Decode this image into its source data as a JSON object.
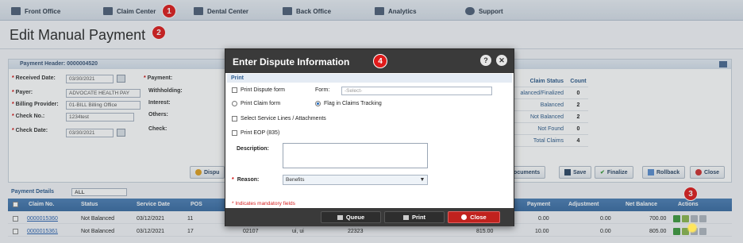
{
  "nav": {
    "items": [
      {
        "label": "Front Office",
        "icon": "front-office-icon"
      },
      {
        "label": "Claim Center",
        "icon": "claim-center-icon"
      },
      {
        "label": "Dental Center",
        "icon": "dental-center-icon"
      },
      {
        "label": "Back Office",
        "icon": "back-office-icon"
      },
      {
        "label": "Analytics",
        "icon": "analytics-icon"
      },
      {
        "label": "Support",
        "icon": "support-icon"
      }
    ]
  },
  "page": {
    "title": "Edit Manual Payment"
  },
  "badges": [
    "1",
    "2",
    "3",
    "4"
  ],
  "payment_header": {
    "title": "Payment Header: 0000004520",
    "received_date_label": "Received Date:",
    "received_date": "03/30/2021",
    "payer_label": "Payer:",
    "payer": "ADVOCATE HEALTH PAY",
    "billing_provider_label": "Billing Provider:",
    "billing_provider": "01-BILL Billing Office",
    "check_no_label": "Check No.:",
    "check_no": "1234test",
    "check_date_label": "Check Date:",
    "check_date": "03/30/2021",
    "payment_label": "Payment:",
    "withholding_label": "Withholding:",
    "interest_label": "Interest:",
    "others_label": "Others:",
    "check_label": "Check:"
  },
  "claim_status": {
    "header": "Claim Status",
    "count_header": "Count",
    "rows": [
      {
        "label": "alanced/Finalized",
        "count": "0"
      },
      {
        "label": "Balanced",
        "count": "2"
      },
      {
        "label": "Not Balanced",
        "count": "2"
      },
      {
        "label": "Not Found",
        "count": "0"
      },
      {
        "label": "Total Claims",
        "count": "4"
      }
    ]
  },
  "actions": {
    "dispute": "Dispu",
    "documents": "Documents",
    "save": "Save",
    "finalize": "Finalize",
    "rollback": "Rollback",
    "close": "Close"
  },
  "details": {
    "title": "Payment Details",
    "filter": "ALL",
    "columns": [
      "Claim No.",
      "Status",
      "Service Date",
      "POS",
      "Payment",
      "Adjustment",
      "Net Balance",
      "Actions"
    ],
    "rows": [
      {
        "claim": "0000015360",
        "status": "Not Balanced",
        "date": "03/12/2021",
        "pos": "11",
        "c5": "",
        "c6": "",
        "c7": "",
        "c8": "",
        "payment": "0.00",
        "adjustment": "0.00",
        "net": "700.00"
      },
      {
        "claim": "0000015361",
        "status": "Not Balanced",
        "date": "03/12/2021",
        "pos": "17",
        "c5": "02107",
        "c6": "ui, ui",
        "c7": "22323",
        "c8": "815.00",
        "payment": "10.00",
        "adjustment": "0.00",
        "net": "805.00"
      }
    ]
  },
  "modal": {
    "title": "Enter Dispute Information",
    "section": "Print",
    "print_dispute": "Print Dispute form",
    "form_label": "Form:",
    "form_placeholder": "-Select-",
    "print_claim": "Print Claim form",
    "flag_tracking": "Flag in Claims Tracking",
    "select_lines": "Select Service Lines / Attachments",
    "print_eop": "Print EOP (835)",
    "description_label": "Description:",
    "reason_label": "Reason:",
    "reason_value": "Benefits",
    "mandatory_note": "* Indicates mandatory fields",
    "queue": "Queue",
    "print": "Print",
    "close": "Close"
  },
  "colors": {
    "accent": "#3a6ca2",
    "badge": "#e01b1b",
    "modal_header": "#3a3a3a"
  }
}
